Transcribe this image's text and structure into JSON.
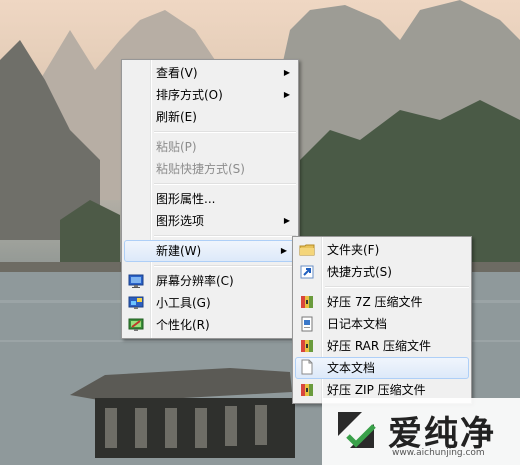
{
  "context_menu": {
    "items": [
      {
        "label": "查看(V)"
      },
      {
        "label": "排序方式(O)"
      },
      {
        "label": "刷新(E)"
      },
      {
        "label": "粘贴(P)"
      },
      {
        "label": "粘贴快捷方式(S)"
      },
      {
        "label": "图形属性..."
      },
      {
        "label": "图形选项"
      },
      {
        "label": "新建(W)"
      },
      {
        "label": "屏幕分辨率(C)"
      },
      {
        "label": "小工具(G)"
      },
      {
        "label": "个性化(R)"
      }
    ]
  },
  "new_submenu": {
    "items": [
      {
        "label": "文件夹(F)",
        "icon": "folder-icon"
      },
      {
        "label": "快捷方式(S)",
        "icon": "shortcut-icon"
      },
      {
        "label": "好压 7Z 压缩文件",
        "icon": "archive-icon"
      },
      {
        "label": "日记本文档",
        "icon": "journal-icon"
      },
      {
        "label": "好压 RAR 压缩文件",
        "icon": "archive-icon"
      },
      {
        "label": "文本文档",
        "icon": "text-document-icon"
      },
      {
        "label": "好压 ZIP 压缩文件",
        "icon": "archive-icon"
      }
    ]
  },
  "watermark": {
    "brand": "爱纯净",
    "url": "www.aichunjing.com"
  },
  "colors": {
    "menu_bg": "#f0f0f0",
    "menu_border": "#979797",
    "highlight_border": "#aecff7",
    "disabled_text": "#8d8d8d"
  }
}
